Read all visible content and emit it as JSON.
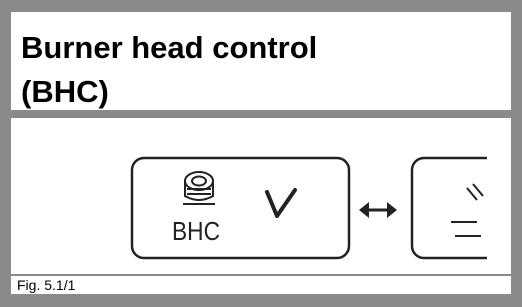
{
  "title": "Burner head control\n(BHC)",
  "figure_caption": "Fig. 5.1/1",
  "display": {
    "bhc_button": {
      "label": "BHC",
      "icon": "burner-head-icon",
      "status_icon": "checkmark-icon"
    },
    "switch_arrow_icon": "double-arrow-icon",
    "next_button": {
      "icon": "partial-icon"
    }
  },
  "colors": {
    "frame": "#8a8a8a",
    "ink": "#222222"
  }
}
